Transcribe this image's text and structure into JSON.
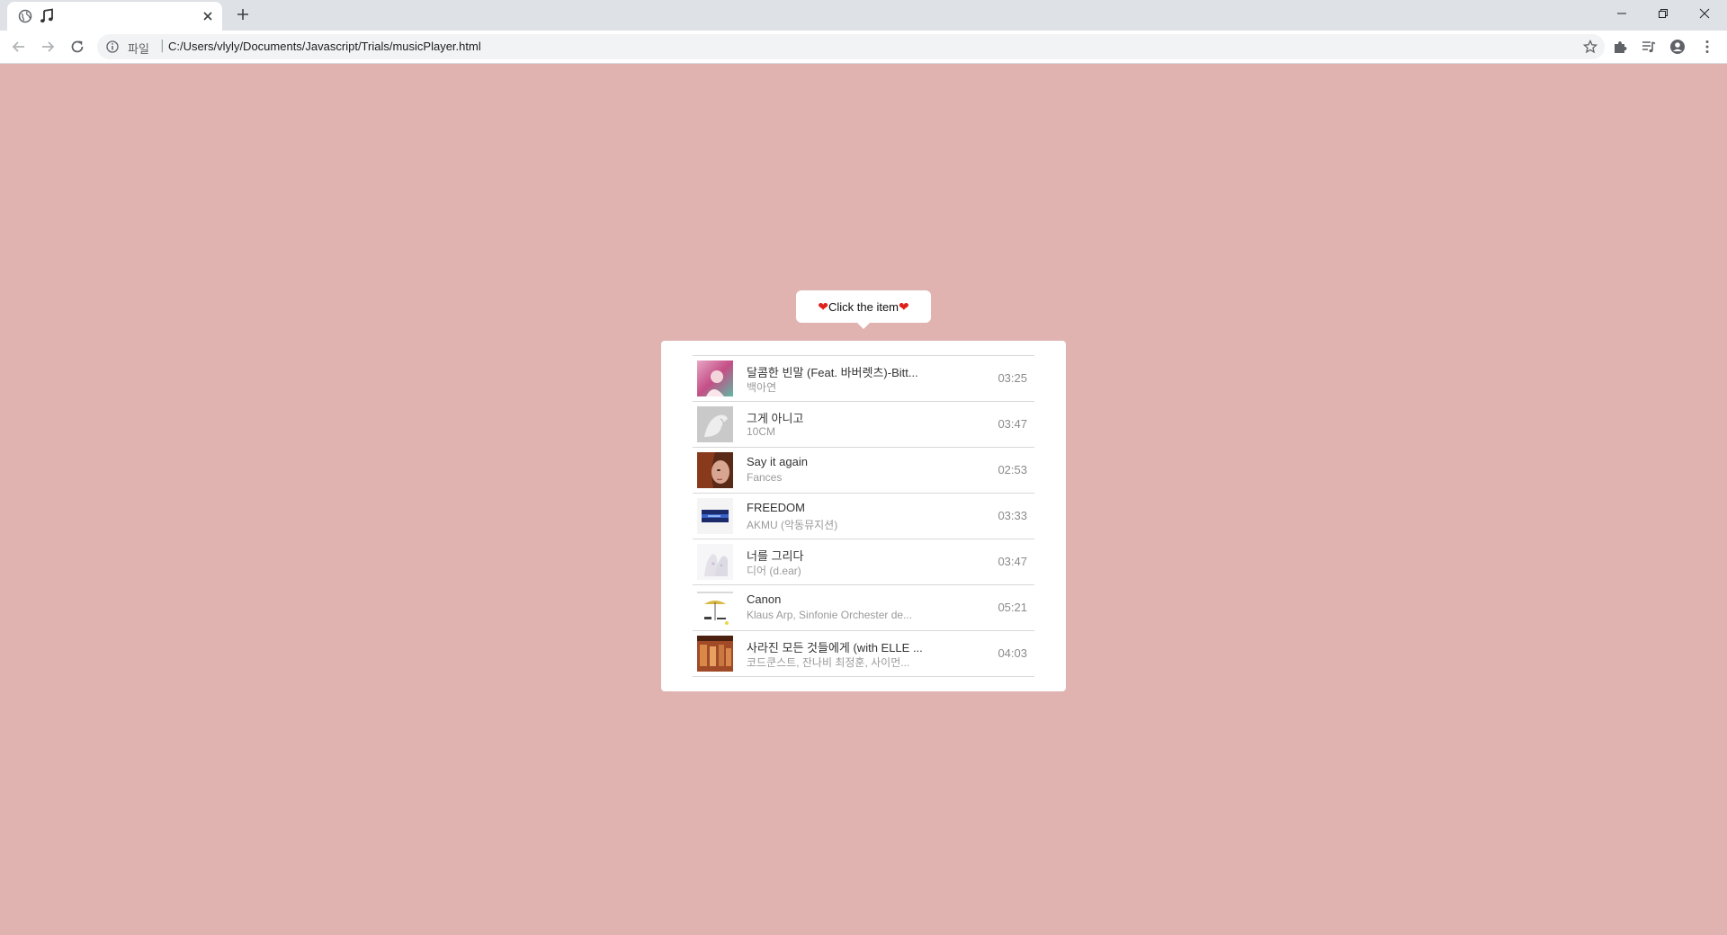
{
  "browser": {
    "tab": {
      "favicon": "globe-icon",
      "title_icon": "music-note-icon",
      "close_icon": "close-icon"
    },
    "new_tab_icon": "plus-icon",
    "window_controls": [
      "minimize-icon",
      "restore-icon",
      "close-icon"
    ],
    "toolbar": {
      "back_icon": "back-arrow-icon",
      "forward_icon": "forward-arrow-icon",
      "reload_icon": "reload-icon",
      "info_icon": "info-icon",
      "scheme_label": "파일",
      "separator": "|",
      "url": "C:/Users/vlyly/Documents/Javascript/Trials/musicPlayer.html",
      "bookmark_icon": "star-icon",
      "extensions_icon": "puzzle-icon",
      "media_icon": "media-queue-icon",
      "profile_icon": "profile-icon",
      "menu_icon": "kebab-menu-icon"
    }
  },
  "page": {
    "background": "#e0b2b0",
    "tooltip": {
      "heart_left": "❤",
      "text": "Click the item",
      "heart_right": "❤"
    },
    "playlist": [
      {
        "title": "달콤한 빈말 (Feat. 바버렛츠)-Bitt...",
        "artist": "백아연",
        "duration": "03:25"
      },
      {
        "title": "그게 아니고",
        "artist": "10CM",
        "duration": "03:47"
      },
      {
        "title": "Say it again",
        "artist": "Fances",
        "duration": "02:53"
      },
      {
        "title": "FREEDOM",
        "artist": "AKMU (악동뮤지션)",
        "duration": "03:33"
      },
      {
        "title": "너를 그리다",
        "artist": "디어 (d.ear)",
        "duration": "03:47"
      },
      {
        "title": "Canon",
        "artist": "Klaus Arp, Sinfonie Orchester de...",
        "duration": "05:21"
      },
      {
        "title": "사라진 모든 것들에게 (with ELLE ...",
        "artist": "코드쿤스트, 잔나비 최정훈, 사이먼...",
        "duration": "04:03"
      }
    ]
  }
}
